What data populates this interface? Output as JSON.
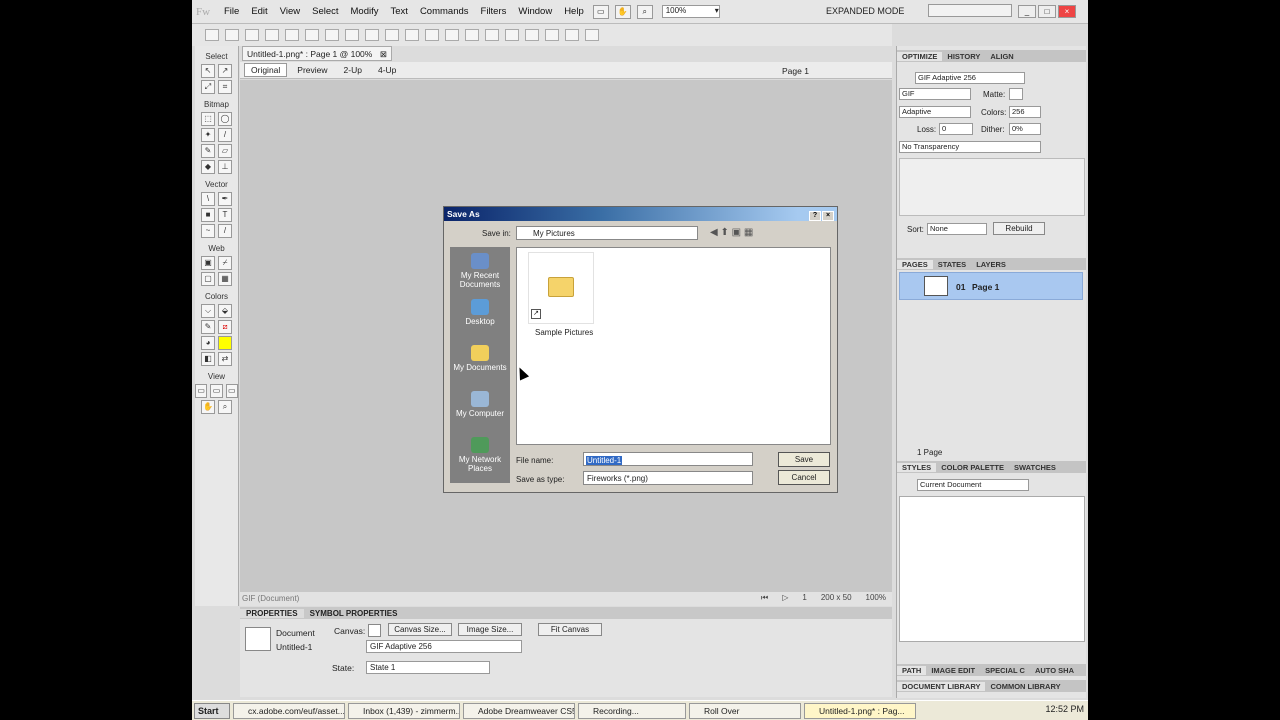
{
  "menubar": {
    "logo": "Fw",
    "menus": [
      "File",
      "Edit",
      "View",
      "Select",
      "Modify",
      "Text",
      "Commands",
      "Filters",
      "Window",
      "Help"
    ],
    "zoom": "100%",
    "mode": "EXPANDED MODE"
  },
  "document_tab": {
    "title": "Untitled-1.png* : Page 1 @ 100%"
  },
  "view_tabs": [
    "Original",
    "Preview",
    "2-Up",
    "4-Up"
  ],
  "page_selector": "Page 1",
  "tools": {
    "sections": [
      "Select",
      "Bitmap",
      "Vector",
      "Web",
      "Colors",
      "View"
    ],
    "fill_color": "#ffff00"
  },
  "status": {
    "left": "GIF (Document)",
    "frame": "1",
    "size": "200 x 50",
    "zoom": "100%"
  },
  "properties": {
    "tabs": [
      "PROPERTIES",
      "SYMBOL PROPERTIES"
    ],
    "doc_label": "Document",
    "doc_name": "Untitled-1",
    "canvas_label": "Canvas:",
    "canvas_size_btn": "Canvas Size...",
    "image_size_btn": "Image Size...",
    "fit_canvas_btn": "Fit Canvas",
    "export_setting": "GIF Adaptive 256",
    "state_label": "State:",
    "state_value": "State 1"
  },
  "optimize": {
    "tabs": [
      "OPTIMIZE",
      "HISTORY",
      "ALIGN"
    ],
    "preset": "GIF Adaptive 256",
    "format": "GIF",
    "matte_label": "Matte:",
    "palette": "Adaptive",
    "colors_label": "Colors:",
    "colors_value": "256",
    "loss_label": "Loss:",
    "loss_value": "0",
    "dither_label": "Dither:",
    "dither_value": "0%",
    "transparency": "No Transparency",
    "sort_label": "Sort:",
    "sort_value": "None",
    "rebuild_btn": "Rebuild"
  },
  "pages_panel": {
    "tabs": [
      "PAGES",
      "STATES",
      "LAYERS"
    ],
    "page_number": "01",
    "page_name": "Page 1",
    "footer": "1 Page"
  },
  "styles_panel": {
    "tabs": [
      "STYLES",
      "COLOR PALETTE",
      "SWATCHES"
    ],
    "selector": "Current Document"
  },
  "bottom_right": {
    "tabs1": [
      "PATH",
      "IMAGE EDIT",
      "SPECIAL C",
      "AUTO SHA"
    ],
    "tabs2": [
      "DOCUMENT LIBRARY",
      "COMMON LIBRARY"
    ]
  },
  "dialog": {
    "title": "Save As",
    "save_in_label": "Save in:",
    "save_in_value": "My Pictures",
    "places": [
      "My Recent Documents",
      "Desktop",
      "My Documents",
      "My Computer",
      "My Network Places"
    ],
    "folder_item": "Sample Pictures",
    "file_name_label": "File name:",
    "file_name_value": "Untitled-1",
    "save_type_label": "Save as type:",
    "save_type_value": "Fireworks (*.png)",
    "save_btn": "Save",
    "cancel_btn": "Cancel"
  },
  "taskbar": {
    "start": "Start",
    "tasks": [
      "cx.adobe.com/euf/asset...",
      "Inbox (1,439) - zimmerm...",
      "Adobe Dreamweaver CS5",
      "Recording...",
      "Roll Over",
      "Untitled-1.png* : Pag..."
    ],
    "clock": "12:52 PM"
  }
}
